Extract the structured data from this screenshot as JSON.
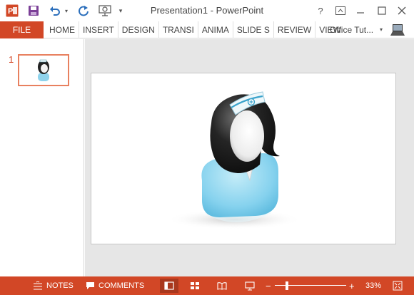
{
  "window": {
    "title": "Presentation1 - PowerPoint",
    "help_label": "?"
  },
  "ribbon": {
    "file_label": "FILE",
    "tabs": [
      {
        "label": "HOME"
      },
      {
        "label": "INSERT"
      },
      {
        "label": "DESIGN"
      },
      {
        "label": "TRANSI"
      },
      {
        "label": "ANIMA"
      },
      {
        "label": "SLIDE S"
      },
      {
        "label": "REVIEW"
      },
      {
        "label": "VIEW"
      }
    ],
    "account_label": "Office Tut..."
  },
  "slides_pane": {
    "slide_number": "1"
  },
  "status": {
    "notes_label": "NOTES",
    "comments_label": "COMMENTS",
    "zoom_label": "33%",
    "zoom_fraction": 0.33
  },
  "colors": {
    "accent": "#d24726",
    "accent_dark": "#a9381e",
    "quick_access_icons": "#7b3f97"
  }
}
